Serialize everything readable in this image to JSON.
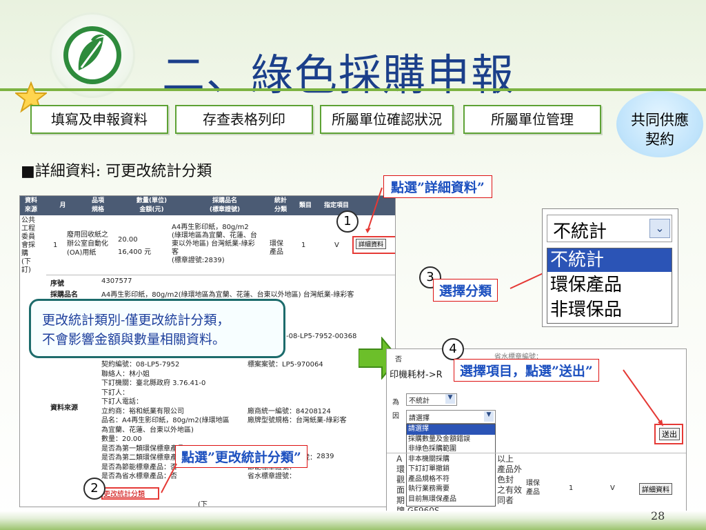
{
  "title": "二、綠色採購申報",
  "nav_tabs": [
    "填寫及申報資料",
    "存查表格列印",
    "所屬單位確認狀況",
    "所屬單位管理"
  ],
  "contract_badge": [
    "共同供應",
    "契約"
  ],
  "subheading": "■詳細資料: 可更改統計分類",
  "table_headers": [
    "資料\n來源",
    "月",
    "品項\n規格",
    "數量(單位)\n金額(元)",
    "採購品名\n(標章證號)",
    "統計\n分類",
    "類目",
    "指定項目"
  ],
  "row": {
    "source": "公共\n工程\n委員\n會採\n購\n(下\n訂)",
    "month": "1",
    "spec": "廢用回收紙之\n辦公室自動化\n(OA)用紙",
    "qty": "20.00",
    "amount": "16,400 元",
    "name": "A4再生影印紙，80g/m2\n(綠環地區為宜蘭、花蓮、台\n東以外地區) 台灣紙業-綠彩\n客\n(標章證號:2839)",
    "stat": "環保\n產品",
    "cat": "1",
    "assigned": "V",
    "detail_btn": "詳細資料"
  },
  "detail": {
    "seq_label": "序號",
    "seq_val": "4307577",
    "name_label": "採購品名",
    "name_val": "A4再生影印紙，80g/m2(綠環地區為宜蘭、花蓮、台東以外地區) 台灣紙業-綠彩客",
    "code_fragment": "-08-LP5-7952-00368",
    "source_label": "資料來源",
    "lines_left": [
      "契約編號：08-LP5-7952",
      "聯絡人：林小姐",
      "下訂機關：臺北縣政府 3.76.41-0",
      "下訂人：",
      "下訂人電話：",
      "立約商：裕和紙業有限公司",
      "品名：A4再生影印紙，80g/m2(綠環地區",
      "為宜蘭、花蓮、台東以外地區)",
      "數量：20.00",
      "是否為第一類環保標章產品：",
      "是否為第二類環保標章產品：否",
      "是否為節能標章產品：否",
      "是否為省水標章產品：否"
    ],
    "lines_right": [
      "標案案號：LP5-970064",
      "",
      "",
      "",
      "",
      "廠商統一編號：84208124",
      "廠牌型號規格：台灣紙業-綠彩客",
      "",
      "",
      "",
      "第二類環保標章證號：",
      "節能標章證號：",
      "省水標章證號："
    ],
    "change_link": "更改統計分類",
    "partial_2839": "2839",
    "bottom_cut": "(下"
  },
  "note": [
    "更改統計類別-僅更改統計分類，",
    "不會影響金額與數量相關資料。"
  ],
  "callouts": {
    "c1": "點選”詳細資料”",
    "c2": "點選”更改統計分類”",
    "c3": "選擇分類",
    "c4": "選擇項目，點選”送出”"
  },
  "steps": [
    "1",
    "2",
    "3",
    "4"
  ],
  "big_dropdown": {
    "selected": "不統計",
    "options": [
      "不統計",
      "環保產品",
      "非環保品"
    ]
  },
  "panel2": {
    "top_no": "否",
    "top_right": "省水標章編號：",
    "desc": "印機耗材->R",
    "desc_tail": "時)",
    "stat_label": "為",
    "stat_value": "不統計",
    "reason_label": "因",
    "reason_value": "請選擇",
    "reason_options": [
      "請選擇",
      "採購數量及金額錯誤",
      "非綠色採購範圍",
      "非本機關採購",
      "下訂訂單撤銷",
      "產品規格不符",
      "執行業務需要",
      "目前無環保產品"
    ],
    "submit": "送出",
    "left_col": [
      "A",
      "環",
      "觀",
      "面",
      "期",
      "牌 GF960S"
    ],
    "right_col": [
      "以上",
      "產品外",
      "色封",
      "之有效",
      "同者"
    ],
    "stat2": "環保\n產品",
    "cat2": "1",
    "assigned2": "V",
    "detail_btn2": "詳細資料"
  },
  "page_number": "28"
}
